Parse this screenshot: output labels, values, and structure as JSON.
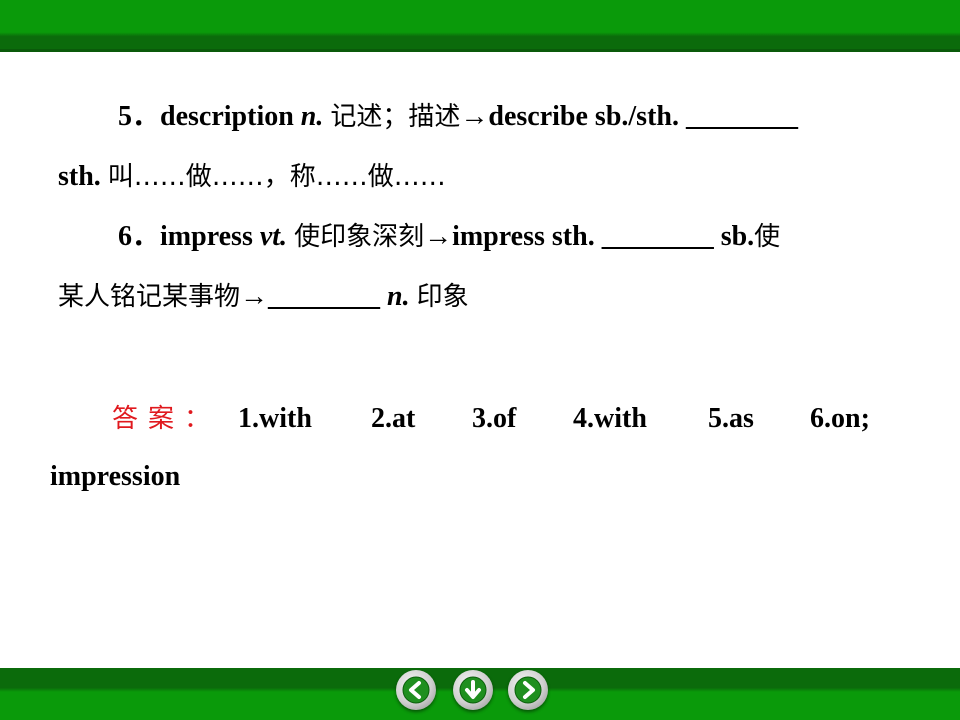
{
  "lines": {
    "l1": {
      "num": "5．",
      "word": "description",
      "pos": "n.",
      "cn1": "记述；描述",
      "arrow": "→",
      "phrase": "describe sb./sth.",
      "blank": "________"
    },
    "l2": {
      "start": "sth.",
      "cn": "叫……做……，称……做……"
    },
    "l3": {
      "num": "6．",
      "word": "impress",
      "pos": "vt.",
      "cn1": "使印象深刻",
      "arrow": "→",
      "phrase": "impress sth.",
      "blank": "________",
      "tail": "sb.",
      "cn2": "使"
    },
    "l4": {
      "cn": "某人铭记某事物",
      "arrow": "→",
      "blank": "________",
      "pos": "n.",
      "cn2": "印象"
    }
  },
  "answer": {
    "label": "答案：",
    "items": [
      "1.with",
      "2.at",
      "3.of",
      "4.with",
      "5.as",
      "6.on;"
    ],
    "continued": "impression"
  },
  "nav": {
    "prev_icon": "arrow-left-icon",
    "home_icon": "arrow-down-icon",
    "next_icon": "arrow-right-icon"
  },
  "colors": {
    "bar_green": "#0a9a0a",
    "bar_dark_green": "#0b6b0b",
    "answer_label": "#e0191e"
  }
}
